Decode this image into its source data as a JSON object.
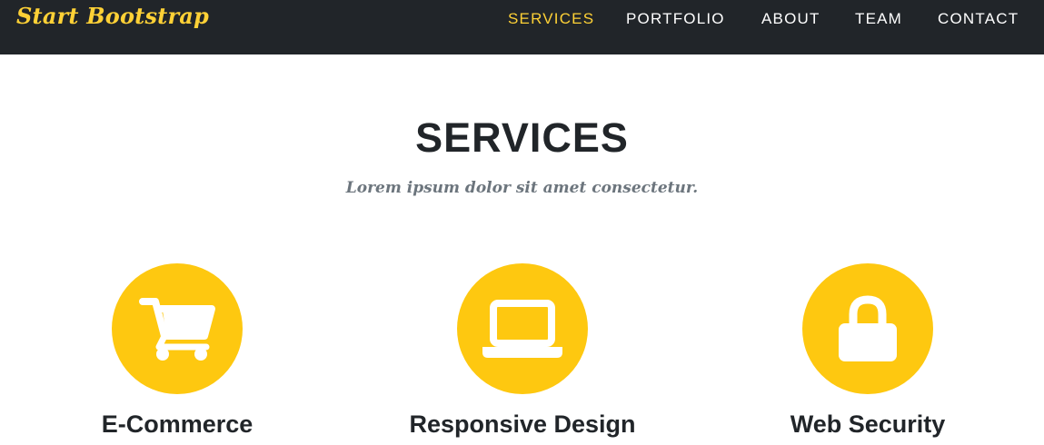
{
  "brand": "Start Bootstrap",
  "nav": {
    "items": [
      {
        "label": "SERVICES",
        "active": true
      },
      {
        "label": "PORTFOLIO",
        "active": false
      },
      {
        "label": "ABOUT",
        "active": false
      },
      {
        "label": "TEAM",
        "active": false
      },
      {
        "label": "CONTACT",
        "active": false
      }
    ]
  },
  "services_section": {
    "heading": "SERVICES",
    "subheading": "Lorem ipsum dolor sit amet consectetur.",
    "items": [
      {
        "title": "E-Commerce",
        "icon": "shopping-cart-icon"
      },
      {
        "title": "Responsive Design",
        "icon": "laptop-icon"
      },
      {
        "title": "Web Security",
        "icon": "lock-icon"
      }
    ]
  },
  "colors": {
    "navbar_bg": "#212529",
    "accent": "#fed136",
    "icon_circle": "#fec810",
    "heading_text": "#212529",
    "muted_text": "#6c757d"
  }
}
